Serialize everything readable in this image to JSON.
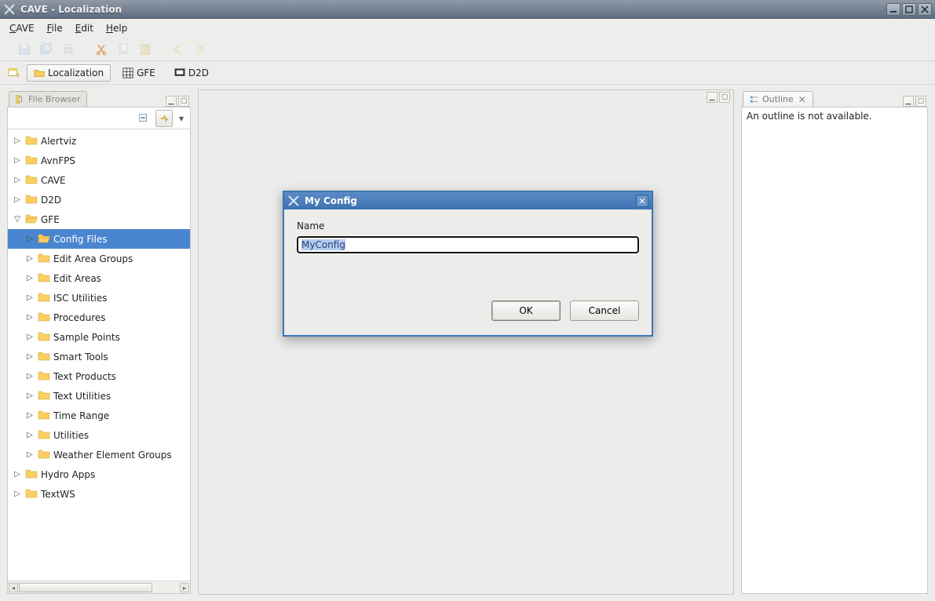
{
  "window": {
    "title": "CAVE - Localization"
  },
  "menu": {
    "items": [
      "CAVE",
      "File",
      "Edit",
      "Help"
    ]
  },
  "perspectives": {
    "open_icon": "open-perspective-icon",
    "tabs": [
      {
        "label": "Localization",
        "icon": "folder-icon",
        "active": true
      },
      {
        "label": "GFE",
        "icon": "grid-icon",
        "active": false
      },
      {
        "label": "D2D",
        "icon": "display-icon",
        "active": false
      }
    ]
  },
  "fileBrowser": {
    "tab": "File Browser",
    "tree": [
      {
        "label": "Alertviz",
        "depth": 0,
        "open": false
      },
      {
        "label": "AvnFPS",
        "depth": 0,
        "open": false
      },
      {
        "label": "CAVE",
        "depth": 0,
        "open": false
      },
      {
        "label": "D2D",
        "depth": 0,
        "open": false
      },
      {
        "label": "GFE",
        "depth": 0,
        "open": true
      },
      {
        "label": "Config Files",
        "depth": 1,
        "open": false,
        "selected": true,
        "folderOpen": true
      },
      {
        "label": "Edit Area Groups",
        "depth": 1,
        "open": false
      },
      {
        "label": "Edit Areas",
        "depth": 1,
        "open": false
      },
      {
        "label": "ISC Utilities",
        "depth": 1,
        "open": false
      },
      {
        "label": "Procedures",
        "depth": 1,
        "open": false
      },
      {
        "label": "Sample Points",
        "depth": 1,
        "open": false
      },
      {
        "label": "Smart Tools",
        "depth": 1,
        "open": false
      },
      {
        "label": "Text Products",
        "depth": 1,
        "open": false
      },
      {
        "label": "Text Utilities",
        "depth": 1,
        "open": false
      },
      {
        "label": "Time Range",
        "depth": 1,
        "open": false
      },
      {
        "label": "Utilities",
        "depth": 1,
        "open": false
      },
      {
        "label": "Weather Element Groups",
        "depth": 1,
        "open": false
      },
      {
        "label": "Hydro Apps",
        "depth": 0,
        "open": false
      },
      {
        "label": "TextWS",
        "depth": 0,
        "open": false
      }
    ]
  },
  "outline": {
    "tab": "Outline",
    "message": "An outline is not available."
  },
  "dialog": {
    "title": "My Config",
    "fieldLabel": "Name",
    "value": "MyConfig",
    "ok": "OK",
    "cancel": "Cancel"
  }
}
